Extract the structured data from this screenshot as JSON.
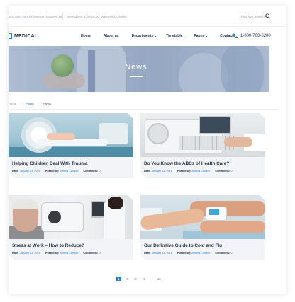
{
  "topbar": {
    "address": "Box 485, 55 Kirk Avenue, Maxwell Hill",
    "hours": "Weekdays: 8:00-20:00, Weekend: Closed",
    "search_placeholder": "Find We Search?"
  },
  "nav": {
    "logo": "MEDICAL",
    "items": [
      {
        "label": "Home",
        "has_dropdown": false
      },
      {
        "label": "About us",
        "has_dropdown": false
      },
      {
        "label": "Departments",
        "has_dropdown": true
      },
      {
        "label": "Timetable",
        "has_dropdown": false
      },
      {
        "label": "Pages",
        "has_dropdown": true
      },
      {
        "label": "Contact",
        "has_dropdown": false
      }
    ],
    "phone": "1-800-700-6200"
  },
  "hero": {
    "title": "News"
  },
  "breadcrumb": {
    "home": "Home",
    "pages": "Pages",
    "current": "News"
  },
  "meta_labels": {
    "date": "Date:",
    "posted_by": "Posted by:",
    "comments": "Comments:"
  },
  "posts": [
    {
      "title": "Helping Children Deal With Trauma",
      "date": "January 23, 2016",
      "author": "Amelia Condon",
      "comments": "0"
    },
    {
      "title": "Do You Know the ABCs of Health Care?",
      "date": "January 23, 2016",
      "author": "Amelia Condon",
      "comments": "0"
    },
    {
      "title": "Stress at Work – How to Reduce?",
      "date": "January 23, 2016",
      "author": "Amelia Condon",
      "comments": "0"
    },
    {
      "title": "Our Definitive Guide to Cold and Flu",
      "date": "January 23, 2016",
      "author": "Amelia Condon",
      "comments": "0"
    }
  ],
  "pagination": {
    "pages": [
      "1",
      "2",
      "3",
      "4"
    ],
    "ellipsis": "...",
    "last": "12",
    "active": "1"
  },
  "colors": {
    "accent": "#2a7ed1",
    "heading": "#1f2d3d",
    "card_bg": "#f2f4f8"
  },
  "icons": [
    "search-icon",
    "phone-icon",
    "chevron-down-icon",
    "logo-mark-icon"
  ]
}
